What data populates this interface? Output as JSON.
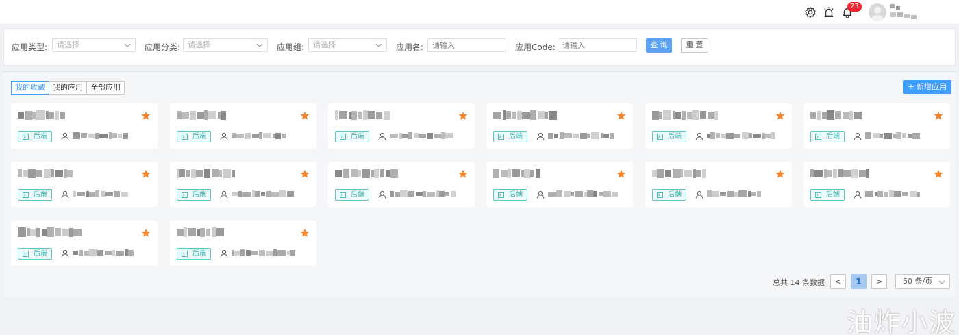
{
  "header": {
    "notification_count": "23",
    "icons": [
      "gear-icon",
      "alarm-icon",
      "bell-icon",
      "avatar-icon"
    ]
  },
  "filters": {
    "app_type_label": "应用类型:",
    "app_type_placeholder": "请选择",
    "app_category_label": "应用分类:",
    "app_category_placeholder": "请选择",
    "app_group_label": "应用组:",
    "app_group_placeholder": "请选择",
    "app_name_label": "应用名:",
    "app_name_placeholder": "请输入",
    "app_code_label": "应用Code:",
    "app_code_placeholder": "请输入",
    "query_label": "查 询",
    "reset_label": "重 置"
  },
  "tabs": [
    {
      "label": "我的收藏",
      "active": true
    },
    {
      "label": "我的应用",
      "active": false
    },
    {
      "label": "全部应用",
      "active": false
    }
  ],
  "add_app_label": "+ 新增应用",
  "cards": [
    {
      "tag": "后端",
      "favorited": true
    },
    {
      "tag": "后端",
      "favorited": true
    },
    {
      "tag": "后端",
      "favorited": true
    },
    {
      "tag": "后端",
      "favorited": true
    },
    {
      "tag": "后端",
      "favorited": true
    },
    {
      "tag": "后端",
      "favorited": true
    },
    {
      "tag": "后端",
      "favorited": true
    },
    {
      "tag": "后端",
      "favorited": true
    },
    {
      "tag": "后端",
      "favorited": true
    },
    {
      "tag": "后端",
      "favorited": true
    },
    {
      "tag": "后端",
      "favorited": true
    },
    {
      "tag": "后端",
      "favorited": true
    },
    {
      "tag": "后端",
      "favorited": true
    },
    {
      "tag": "后端",
      "favorited": true
    }
  ],
  "pagination": {
    "total_text": "总共 14 条数据",
    "prev": "<",
    "current_page": "1",
    "next": ">",
    "page_size": "50 条/页"
  },
  "watermark": "油炸小波",
  "colors": {
    "primary": "#409eff",
    "star": "#f5862e",
    "tag": "#3fb6b6",
    "badge": "#f5222d"
  }
}
